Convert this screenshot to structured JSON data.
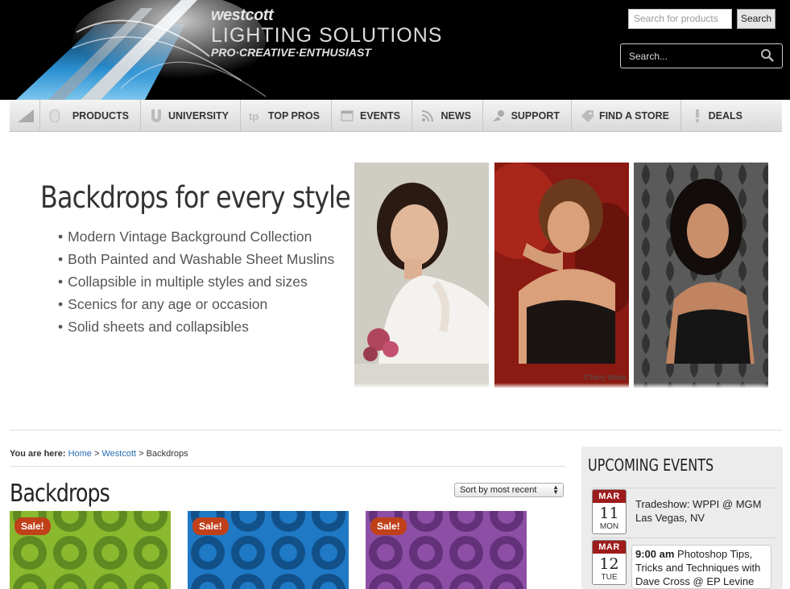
{
  "header": {
    "brand_name": "westcott",
    "brand_title": "LIGHTING SOLUTIONS",
    "brand_tagline": "PRO·CREATIVE·ENTHUSIAST",
    "search_products_placeholder": "Search for products",
    "search_button": "Search",
    "search_dark_placeholder": "Search..."
  },
  "nav": {
    "items": [
      {
        "label": "",
        "icon": "westcott-logo-icon"
      },
      {
        "label": "PRODUCTS",
        "icon": "products-icon"
      },
      {
        "label": "UNIVERSITY",
        "icon": "university-icon"
      },
      {
        "label": "TOP PROS",
        "icon": "top-pros-icon"
      },
      {
        "label": "EVENTS",
        "icon": "events-icon"
      },
      {
        "label": "NEWS",
        "icon": "rss-icon"
      },
      {
        "label": "SUPPORT",
        "icon": "support-icon"
      },
      {
        "label": "FIND A STORE",
        "icon": "tag-icon"
      },
      {
        "label": "DEALS",
        "icon": "exclamation-icon"
      }
    ]
  },
  "hero": {
    "title": "Backdrops for every style",
    "bullets": [
      "Modern Vintage Background Collection",
      "Both Painted and Washable Sheet Muslins",
      "Collapsible in multiple styles and sizes",
      "Scenics for any age or occasion",
      "Solid sheets and collapsibles"
    ],
    "credit_1": "©Terry White",
    "credit_2": "©Terry White"
  },
  "breadcrumb": {
    "prefix": "You are here:",
    "home": "Home",
    "sep1": ">",
    "westcott": "Westcott",
    "sep2": ">",
    "current": "Backdrops"
  },
  "page": {
    "title": "Backdrops",
    "sort_label": "Sort by most recent"
  },
  "products": [
    {
      "badge": "Sale!",
      "color": "#8ab82e"
    },
    {
      "badge": "Sale!",
      "color": "#1f79c4"
    },
    {
      "badge": "Sale!",
      "color": "#8c4fa5"
    }
  ],
  "events": {
    "title": "UPCOMING EVENTS",
    "items": [
      {
        "month": "MAR",
        "day": "11",
        "weekday": "MON",
        "text": "Tradeshow: WPPI @ MGM Las Vegas, NV"
      },
      {
        "month": "MAR",
        "day": "12",
        "weekday": "TUE",
        "time": "9:00 am",
        "text": "Photoshop Tips, Tricks and Techniques with Dave Cross @ EP Levine"
      }
    ]
  }
}
